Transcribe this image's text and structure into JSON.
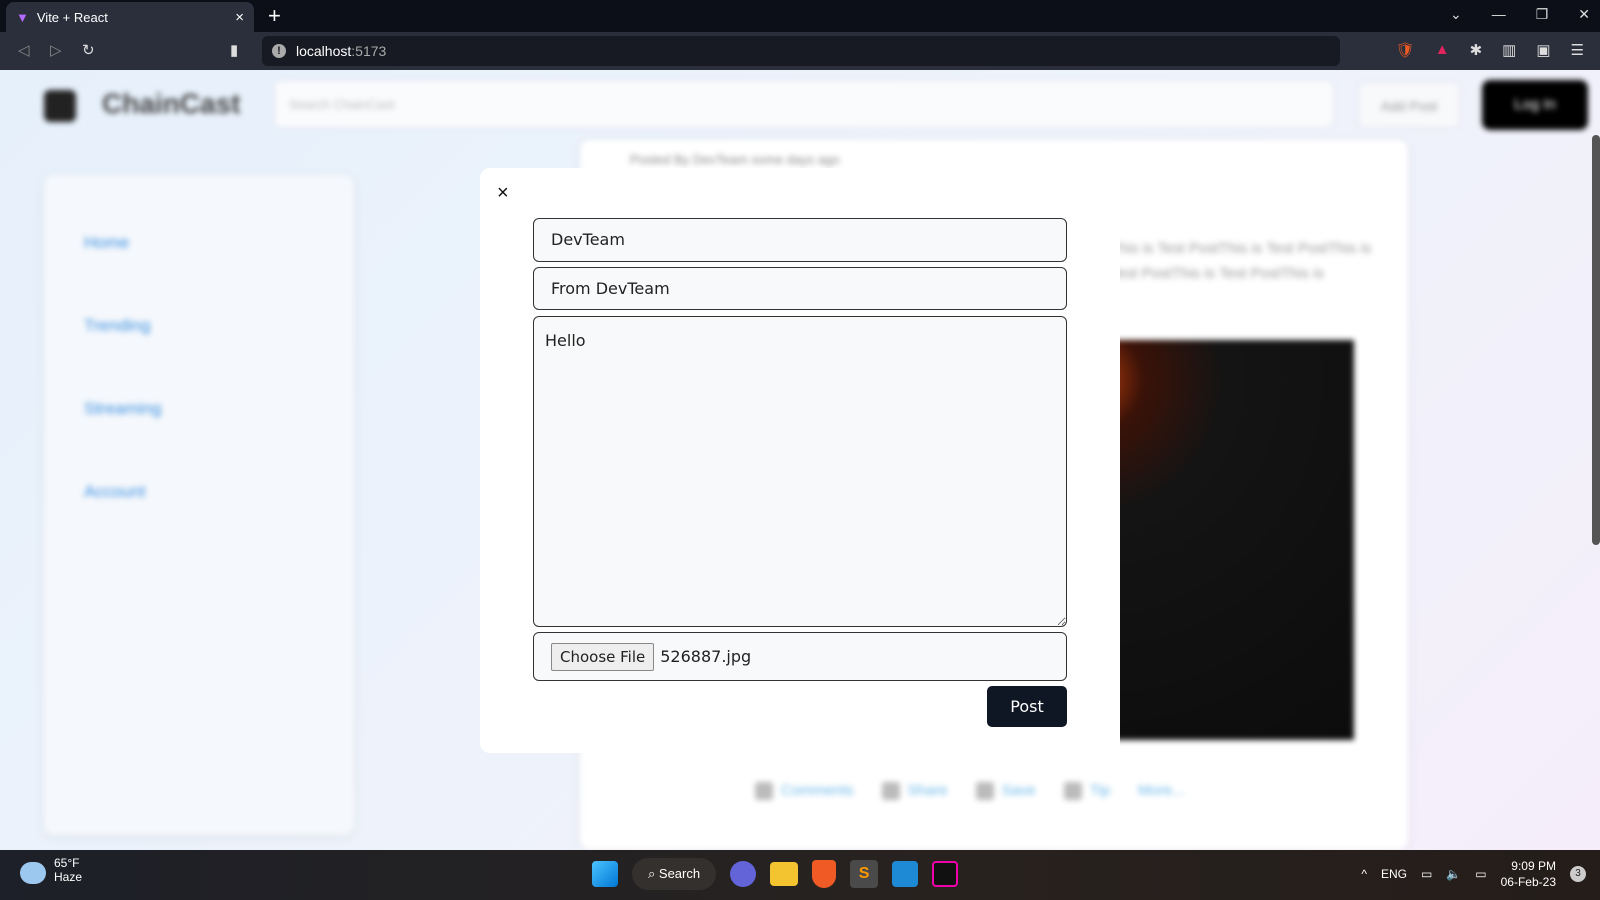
{
  "browser": {
    "tab_title": "Vite + React",
    "url_host": "localhost",
    "url_port": ":5173"
  },
  "app": {
    "brand": "ChainCast",
    "search_placeholder": "Search ChainCast",
    "add_post": "Add Post",
    "login": "Log In",
    "sidebar": [
      {
        "label": "Home"
      },
      {
        "label": "Trending"
      },
      {
        "label": "Streaming"
      },
      {
        "label": "Account"
      }
    ],
    "post": {
      "meta": "Posted By DevTeam some days ago",
      "body": "This is Test PostThis is Test PostThis is Test PostThis is Test PostThis is",
      "actions": [
        {
          "label": "Comments"
        },
        {
          "label": "Share"
        },
        {
          "label": "Save"
        },
        {
          "label": "Tip"
        },
        {
          "label": "More..."
        }
      ]
    }
  },
  "modal": {
    "close": "×",
    "title_value": "DevTeam",
    "subtitle_value": "From DevTeam",
    "body_value": "Hello",
    "choose_file": "Choose File",
    "file_name": "526887.jpg",
    "post": "Post"
  },
  "taskbar": {
    "temp": "65°F",
    "weather": "Haze",
    "search": "Search",
    "lang": "ENG",
    "time": "9:09 PM",
    "date": "06-Feb-23",
    "notifications": "3"
  }
}
